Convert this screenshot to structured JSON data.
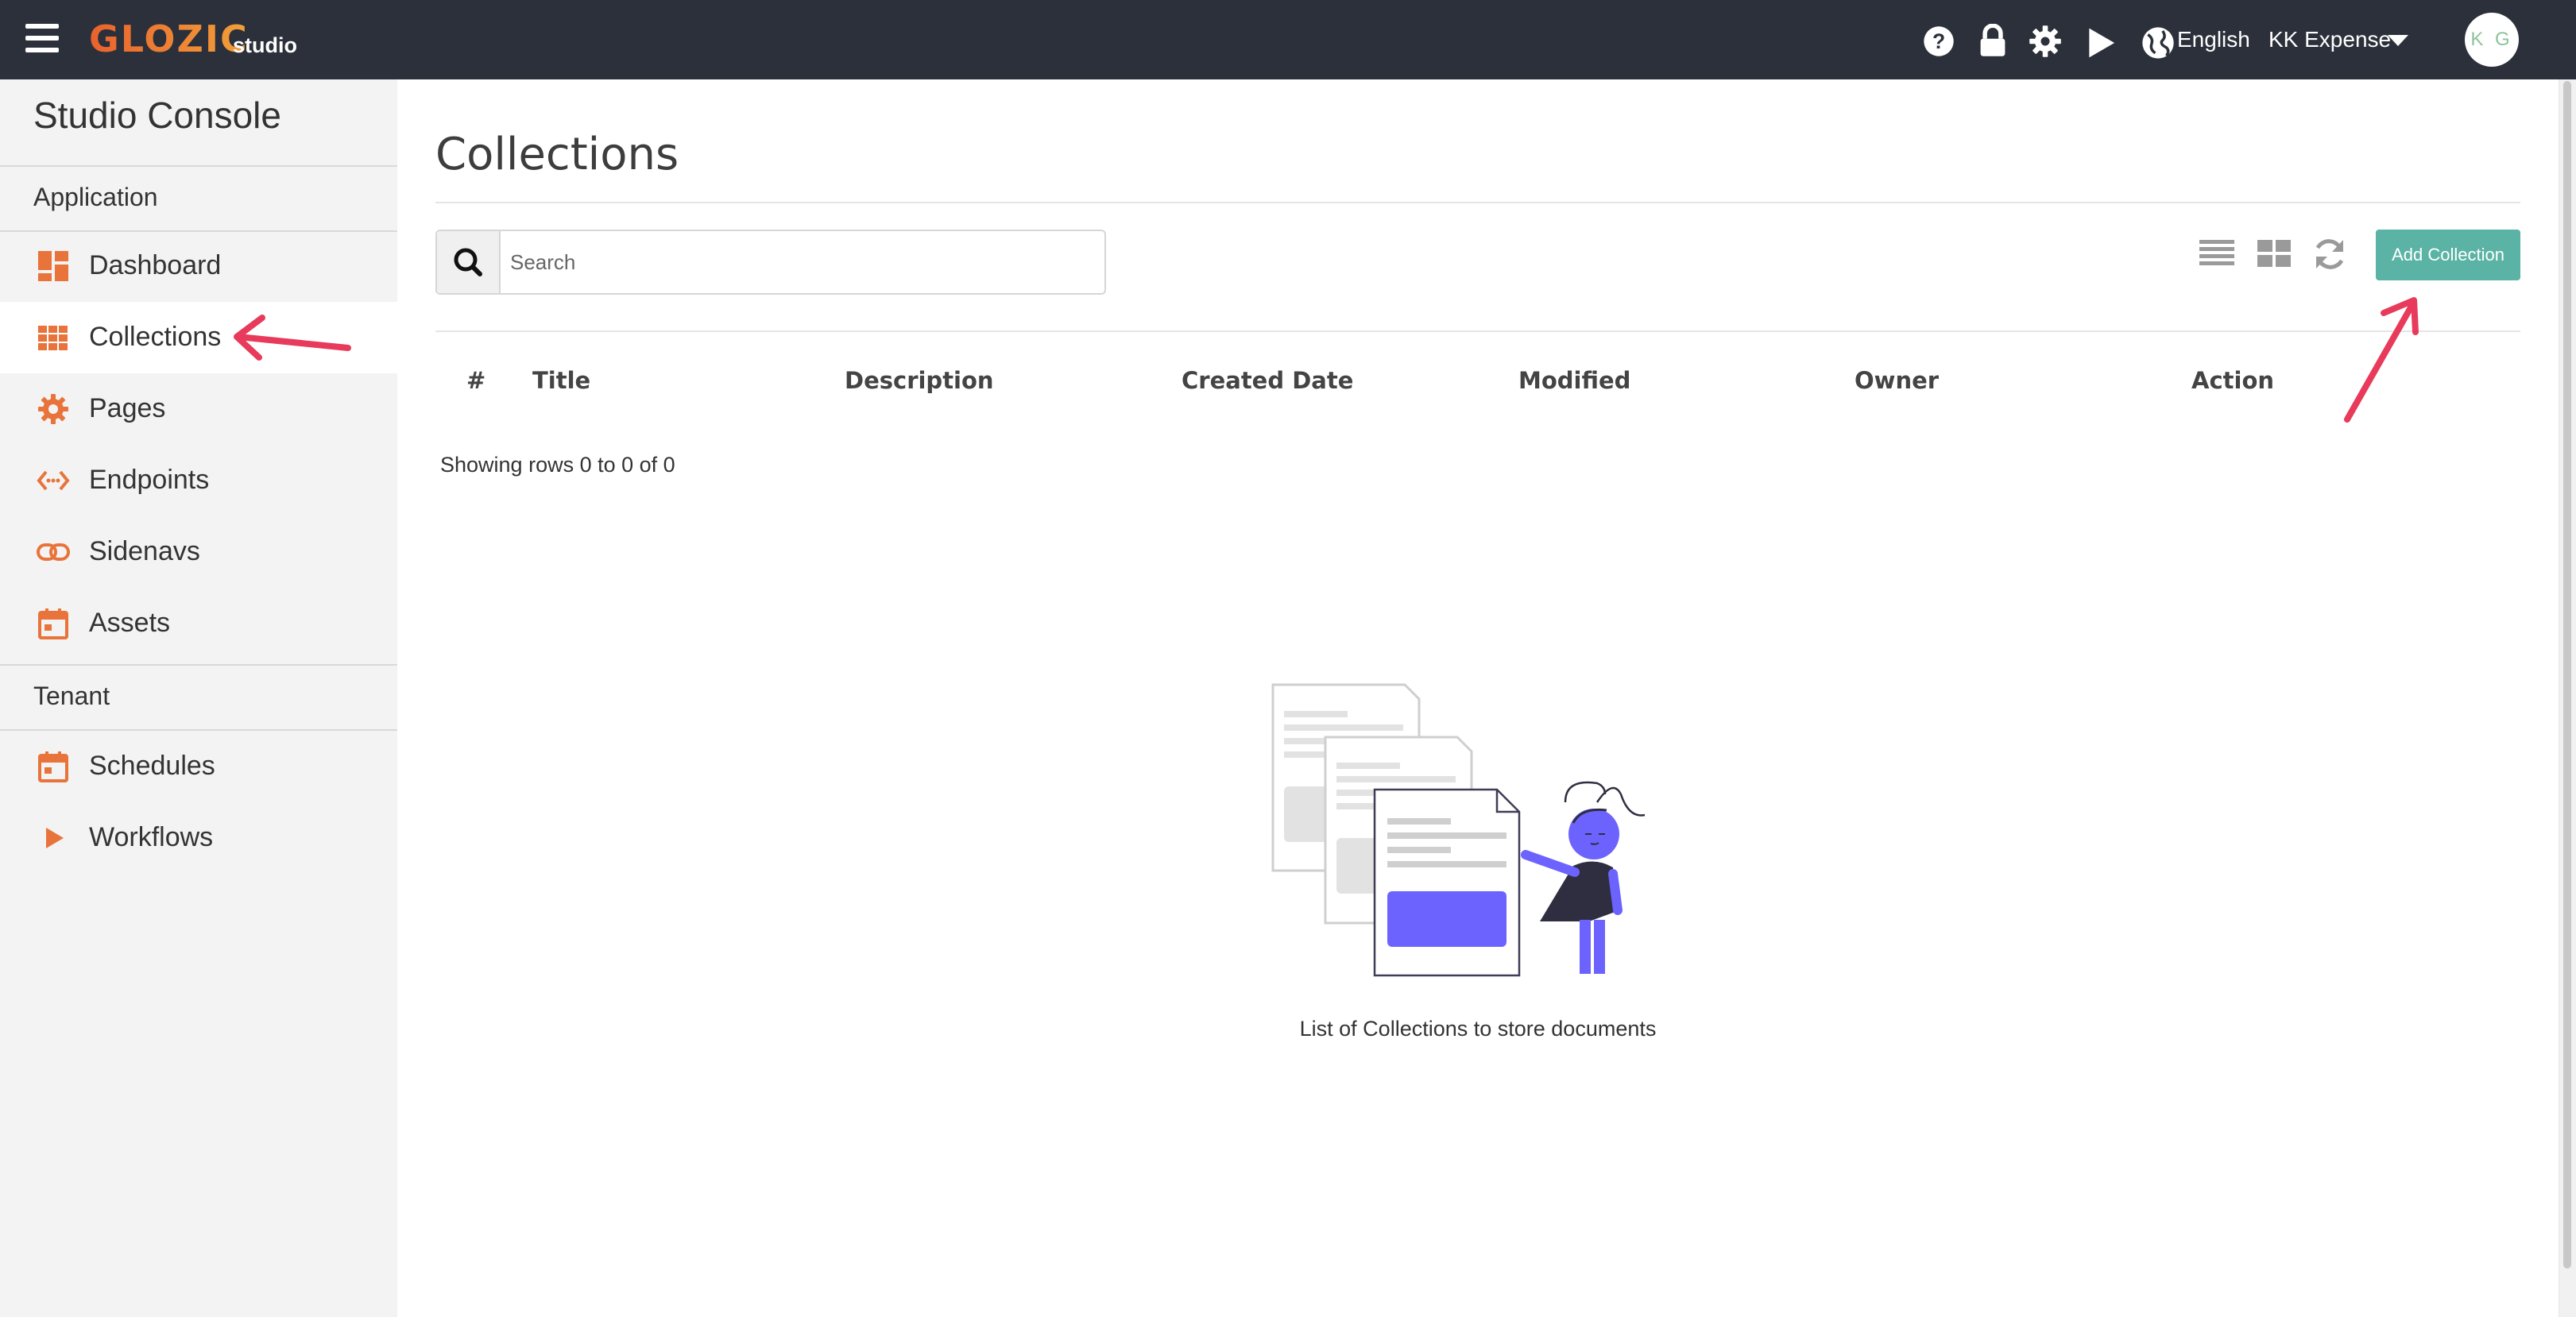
{
  "topbar": {
    "logo_text": "GLOZIC",
    "logo_sub": "studio",
    "icons": [
      "help-icon",
      "lock-icon",
      "gear-icon",
      "play-icon",
      "globe-icon"
    ],
    "language": "English",
    "tenant": "KK Expense",
    "avatar_initials": "K G"
  },
  "sidebar": {
    "title": "Studio Console",
    "sections": [
      {
        "label": "Application"
      },
      {
        "label": "Tenant"
      }
    ],
    "items": [
      {
        "label": "Dashboard",
        "icon": "dashboard-icon"
      },
      {
        "label": "Collections",
        "icon": "grid-icon",
        "active": true
      },
      {
        "label": "Pages",
        "icon": "gear-icon"
      },
      {
        "label": "Endpoints",
        "icon": "code-icon"
      },
      {
        "label": "Sidenavs",
        "icon": "link-icon"
      },
      {
        "label": "Assets",
        "icon": "calendar-icon"
      },
      {
        "label": "Schedules",
        "icon": "calendar-icon"
      },
      {
        "label": "Workflows",
        "icon": "play-icon"
      }
    ]
  },
  "main": {
    "title": "Collections",
    "search": {
      "placeholder": "Search",
      "value": ""
    },
    "toolbar": {
      "list_view_icon": "list-view-icon",
      "grid_view_icon": "grid-view-icon",
      "refresh_icon": "refresh-icon",
      "add_label": "Add Collection"
    },
    "table": {
      "columns": [
        "#",
        "Title",
        "Description",
        "Created Date",
        "Modified",
        "Owner",
        "Action"
      ],
      "rows": [],
      "rows_info": "Showing rows 0 to 0 of 0"
    },
    "empty_state": {
      "caption": "List of Collections to store documents"
    }
  },
  "colors": {
    "topbar": "#2b303a",
    "accent_orange": "#e8743b",
    "add_button": "#5bb3a5",
    "annotation_arrow": "#e83a5a",
    "illustration_purple": "#6c63ff"
  }
}
